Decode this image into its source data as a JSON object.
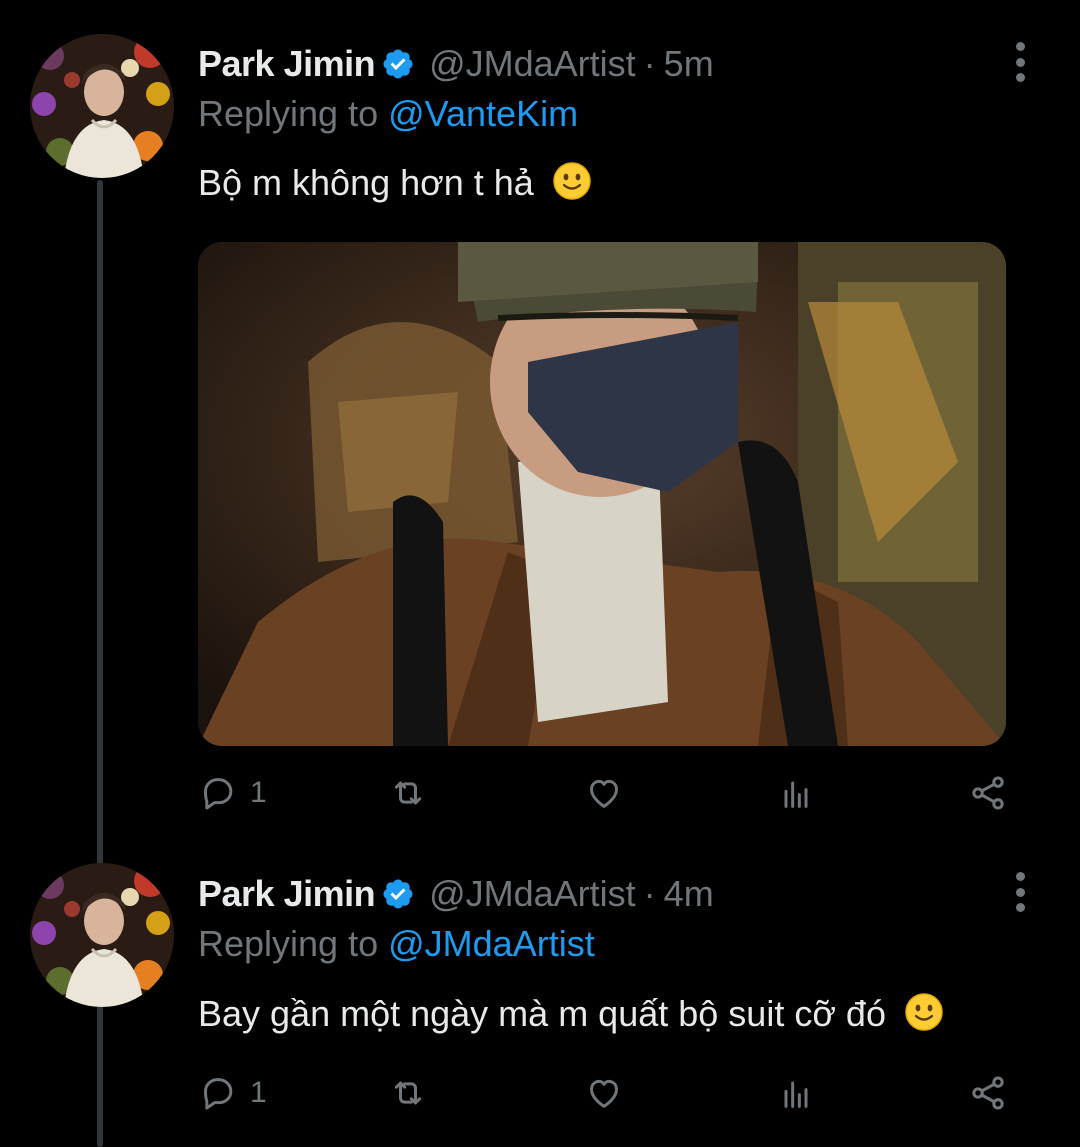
{
  "colors": {
    "background": "#000000",
    "text_primary": "#e7e9ea",
    "text_secondary": "#71767b",
    "accent": "#1d9bf0",
    "thread_line": "#333639"
  },
  "tweets": [
    {
      "display_name": "Park Jimin",
      "handle": "@JMdaArtist",
      "separator": "·",
      "time": "5m",
      "replying_prefix": "Replying to",
      "replying_to": "@VanteKim",
      "text": "Bộ m không hơn t hả",
      "emoji": "slightly-smiling-face",
      "has_media": true,
      "reply_count": "1"
    },
    {
      "display_name": "Park Jimin",
      "handle": "@JMdaArtist",
      "separator": "·",
      "time": "4m",
      "replying_prefix": "Replying to",
      "replying_to": "@JMdaArtist",
      "text": "Bay gần một ngày mà m quất bộ suit cỡ đó",
      "emoji": "slightly-smiling-face",
      "has_media": false,
      "reply_count": "1"
    }
  ],
  "icons": {
    "verified": "verified-badge-icon",
    "more": "more-vertical-icon",
    "reply": "reply-icon",
    "retweet": "retweet-icon",
    "like": "heart-icon",
    "views": "analytics-icon",
    "share": "share-icon"
  }
}
